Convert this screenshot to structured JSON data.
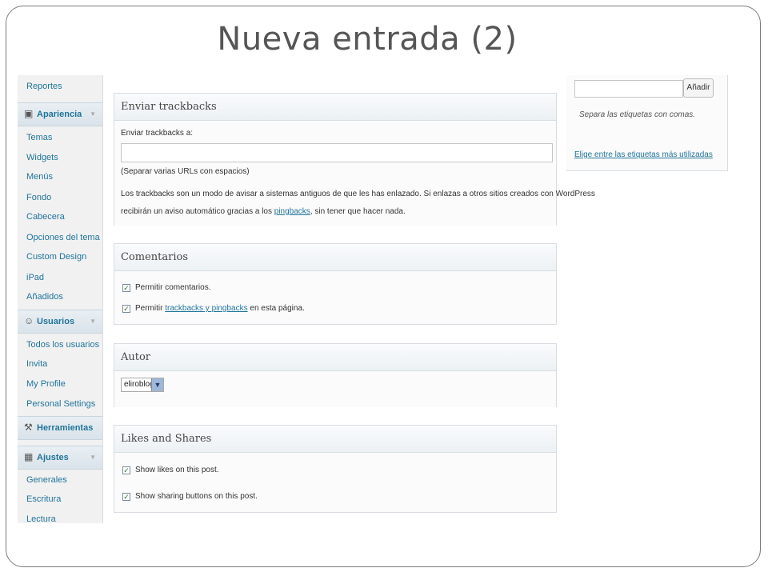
{
  "slide_title": "Nueva entrada (2)",
  "sidebar": {
    "top_item": "Reportes",
    "apariencia": {
      "label": "Apariencia",
      "items": [
        "Temas",
        "Widgets",
        "Menús",
        "Fondo",
        "Cabecera",
        "Opciones del tema",
        "Custom Design",
        "iPad",
        "Añadidos"
      ]
    },
    "usuarios": {
      "label": "Usuarios",
      "items": [
        "Todos los usuarios",
        "Invita",
        "My Profile",
        "Personal Settings"
      ]
    },
    "herramientas": {
      "label": "Herramientas"
    },
    "ajustes": {
      "label": "Ajustes",
      "items": [
        "Generales",
        "Escritura",
        "Lectura"
      ]
    }
  },
  "trackbacks": {
    "title": "Enviar trackbacks",
    "field_label": "Enviar trackbacks a:",
    "field_value": "",
    "hint": "(Separar varias URLs con espacios)",
    "desc_line1": "Los trackbacks son un modo de avisar a sistemas antiguos de que les has enlazado. Si enlazas a otros sitios creados con WordPress",
    "desc_line2_pre": "recibirán un aviso automático gracias a los ",
    "desc_link": "pingbacks",
    "desc_line2_post": ", sin tener que hacer nada."
  },
  "comentarios": {
    "title": "Comentarios",
    "cb1": "Permitir comentarios.",
    "cb2_pre": "Permitir ",
    "cb2_link": "trackbacks y pingbacks",
    "cb2_post": " en esta página."
  },
  "autor": {
    "title": "Autor",
    "selected": "eliroblog"
  },
  "likes": {
    "title": "Likes and Shares",
    "cb1": "Show likes on this post.",
    "cb2": "Show sharing buttons on this post."
  },
  "tags": {
    "add_button": "Añadir",
    "input_value": "",
    "hint": "Separa las etiquetas con comas.",
    "link": "Elige entre las etiquetas más utilizadas"
  },
  "colors": {
    "link": "#21759b",
    "check": "#2d6a2d",
    "sidebar_bg": "#f1f1f1"
  }
}
